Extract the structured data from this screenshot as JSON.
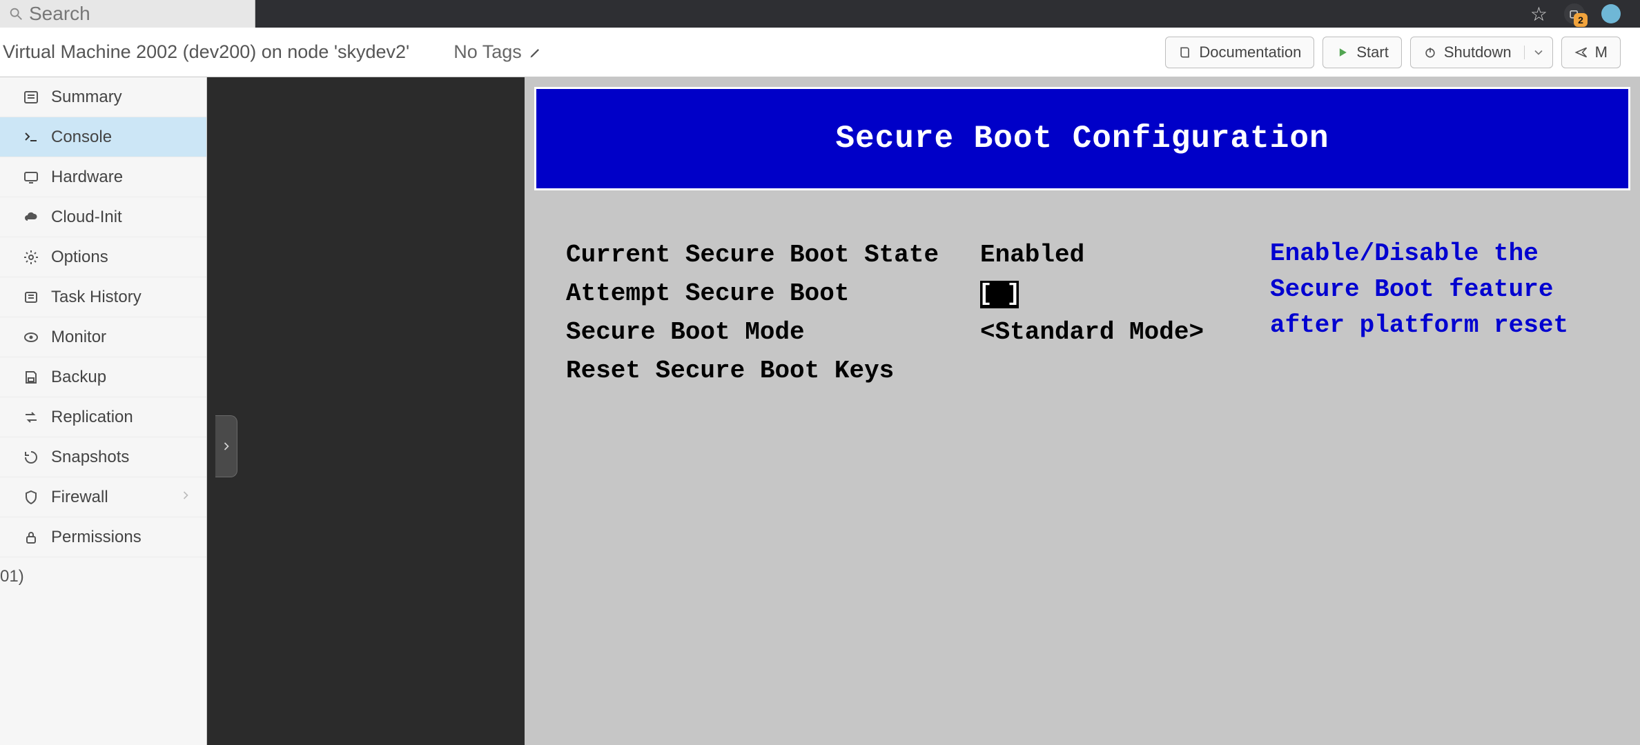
{
  "browser": {
    "search_placeholder": "Search",
    "badge_count": "2"
  },
  "header": {
    "title": "Virtual Machine 2002 (dev200) on node 'skydev2'",
    "no_tags": "No Tags",
    "documentation": "Documentation",
    "start": "Start",
    "shutdown": "Shutdown",
    "more_cut": "M"
  },
  "sidebar": {
    "items": [
      {
        "label": "Summary",
        "icon": "list"
      },
      {
        "label": "Console",
        "icon": "terminal",
        "active": true
      },
      {
        "label": "Hardware",
        "icon": "monitor"
      },
      {
        "label": "Cloud-Init",
        "icon": "cloud"
      },
      {
        "label": "Options",
        "icon": "gear"
      },
      {
        "label": "Task History",
        "icon": "tasks"
      },
      {
        "label": "Monitor",
        "icon": "eye"
      },
      {
        "label": "Backup",
        "icon": "floppy"
      },
      {
        "label": "Replication",
        "icon": "arrows"
      },
      {
        "label": "Snapshots",
        "icon": "history"
      },
      {
        "label": "Firewall",
        "icon": "shield",
        "hasSub": true
      },
      {
        "label": "Permissions",
        "icon": "lock"
      }
    ],
    "stub": "01)"
  },
  "bios": {
    "title": "Secure Boot Configuration",
    "rows": [
      {
        "label": "Current Secure Boot State",
        "value": "Enabled"
      },
      {
        "label": "Attempt Secure Boot",
        "checkbox": true,
        "checked": false
      },
      {
        "label": "Secure Boot Mode",
        "value": "<Standard Mode>"
      },
      {
        "label": "Reset Secure Boot Keys",
        "value": ""
      }
    ],
    "help": [
      "Enable/Disable the",
      "Secure Boot feature",
      "after platform reset"
    ],
    "checkbox_glyph": "[ ]"
  }
}
